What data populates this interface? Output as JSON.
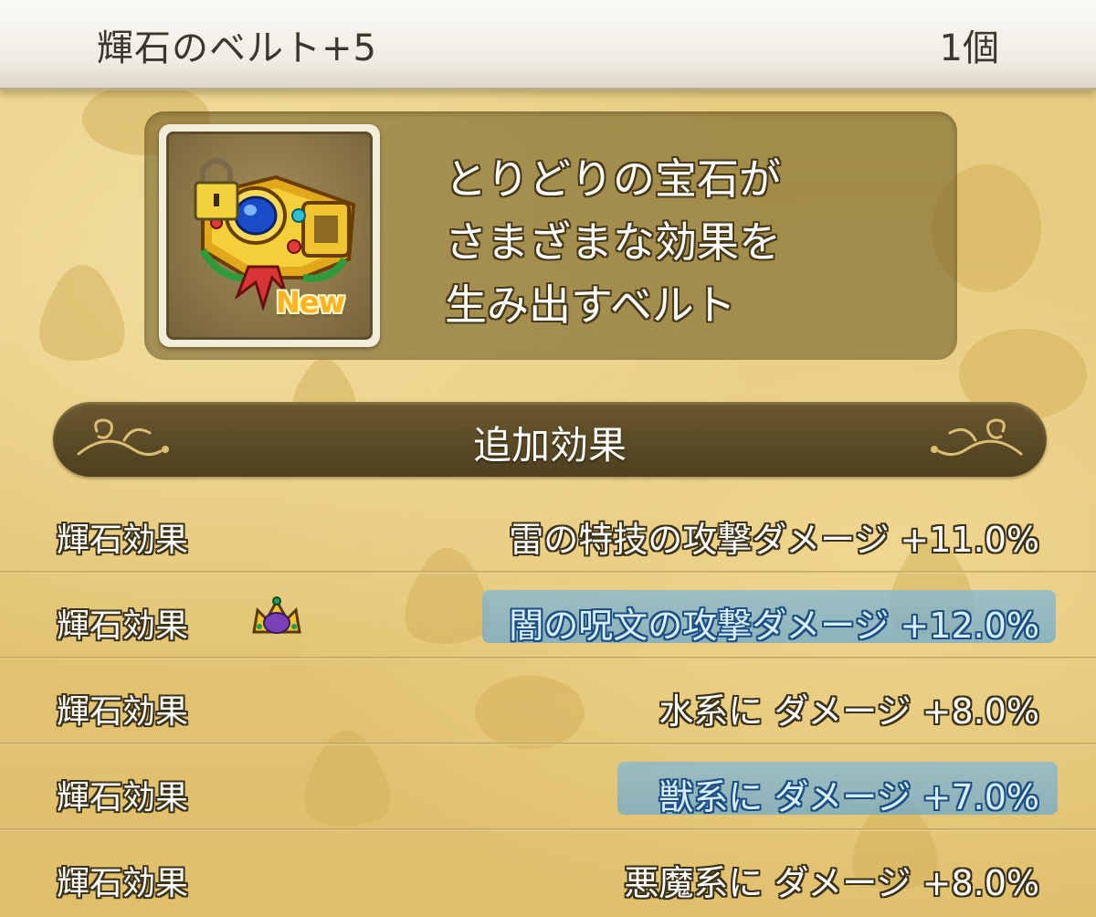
{
  "header": {
    "title": "輝石のベルト+5",
    "count": "1個"
  },
  "item": {
    "icon": "jeweled-belt-icon",
    "lock_icon": "padlock-icon",
    "new_badge": "New",
    "description_lines": [
      "とりどりの宝石が",
      "さまざまな効果を",
      "生み出すベルト"
    ]
  },
  "section": {
    "title": "追加効果"
  },
  "effects": [
    {
      "label": "輝石効果",
      "value": "雷の特技の攻撃ダメージ +11.0%",
      "highlighted": false,
      "icon": ""
    },
    {
      "label": "輝石効果",
      "value": "闇の呪文の攻撃ダメージ +12.0%",
      "highlighted": true,
      "icon": "crown-icon"
    },
    {
      "label": "輝石効果",
      "value": "水系に ダメージ +8.0%",
      "highlighted": false,
      "icon": ""
    },
    {
      "label": "輝石効果",
      "value": "獣系に ダメージ +7.0%",
      "highlighted": true,
      "icon": ""
    },
    {
      "label": "輝石効果",
      "value": "悪魔系に ダメージ +8.0%",
      "highlighted": false,
      "icon": ""
    }
  ],
  "colors": {
    "background": "#e6c978",
    "panel": "#6e5c24",
    "highlight": "#7fb6d6",
    "highlight_text": "#d9f0ff"
  }
}
